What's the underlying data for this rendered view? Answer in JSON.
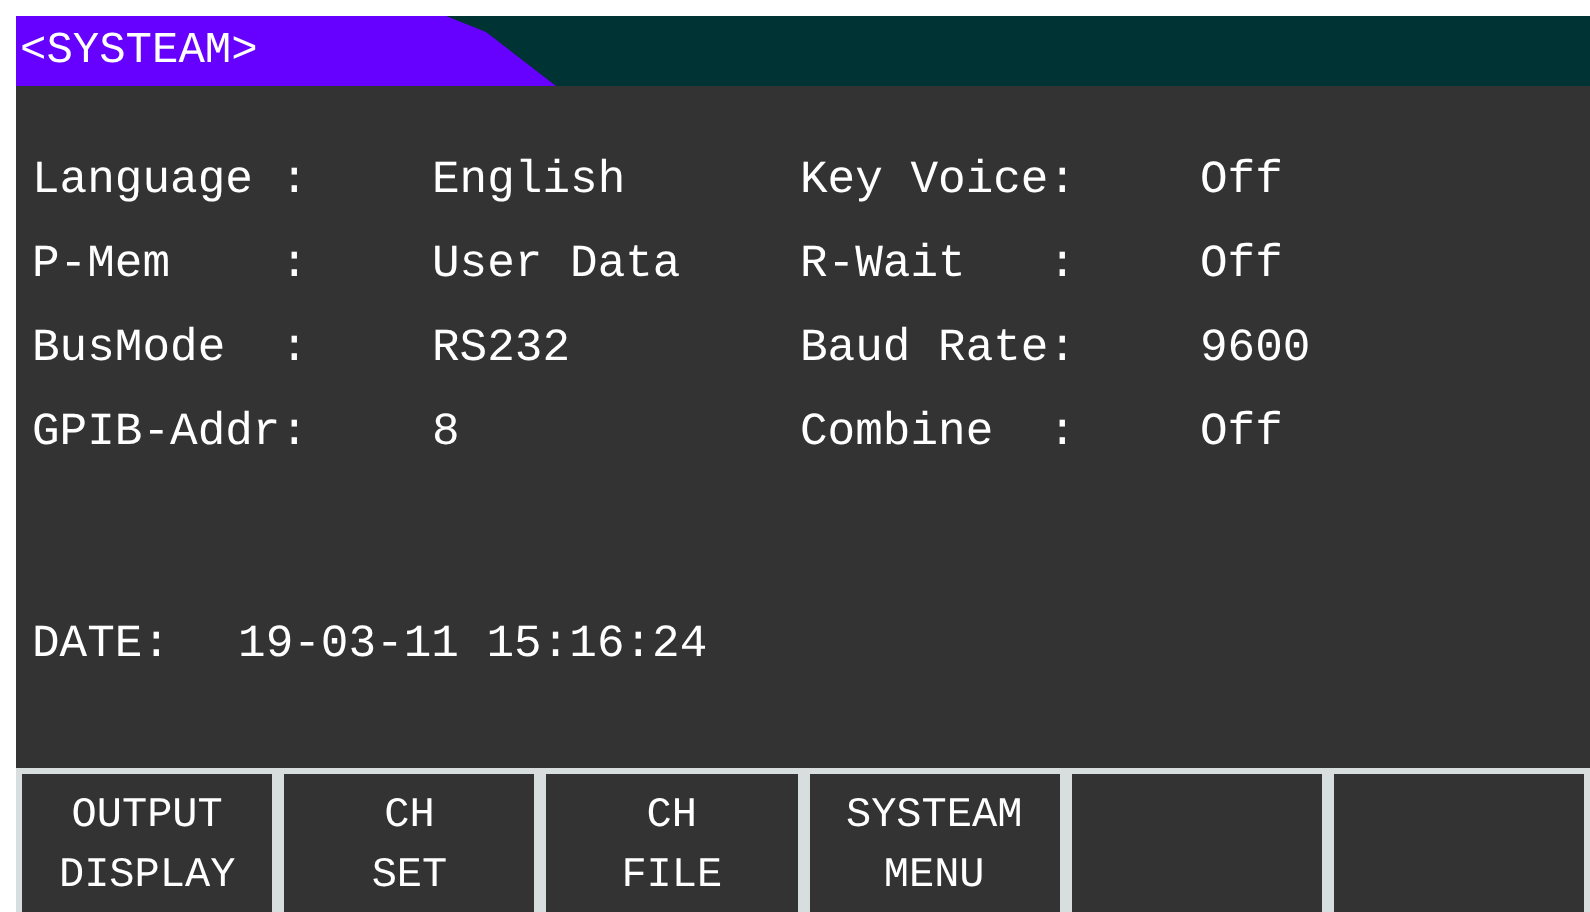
{
  "title": "<SYSTEAM>",
  "settings": [
    {
      "label": "Language :",
      "value": "English"
    },
    {
      "label": "Key Voice:",
      "value": "Off"
    },
    {
      "label": "P-Mem    :",
      "value": "User Data"
    },
    {
      "label": "R-Wait   :",
      "value": "Off"
    },
    {
      "label": "BusMode  :",
      "value": "RS232"
    },
    {
      "label": "Baud Rate:",
      "value": "9600"
    },
    {
      "label": "GPIB-Addr:",
      "value": "8"
    },
    {
      "label": "Combine  :",
      "value": "Off"
    }
  ],
  "date": {
    "label": "DATE:",
    "value": "19-03-11 15:16:24"
  },
  "softkeys": [
    {
      "kind": "labeled",
      "lines": [
        "OUTPUT",
        "DISPLAY"
      ]
    },
    {
      "kind": "labeled",
      "lines": [
        "CH",
        "SET"
      ]
    },
    {
      "kind": "labeled",
      "lines": [
        "CH",
        "FILE"
      ]
    },
    {
      "kind": "labeled",
      "lines": [
        "SYSTEAM",
        "MENU"
      ]
    },
    {
      "kind": "blank"
    },
    {
      "kind": "blank"
    }
  ]
}
